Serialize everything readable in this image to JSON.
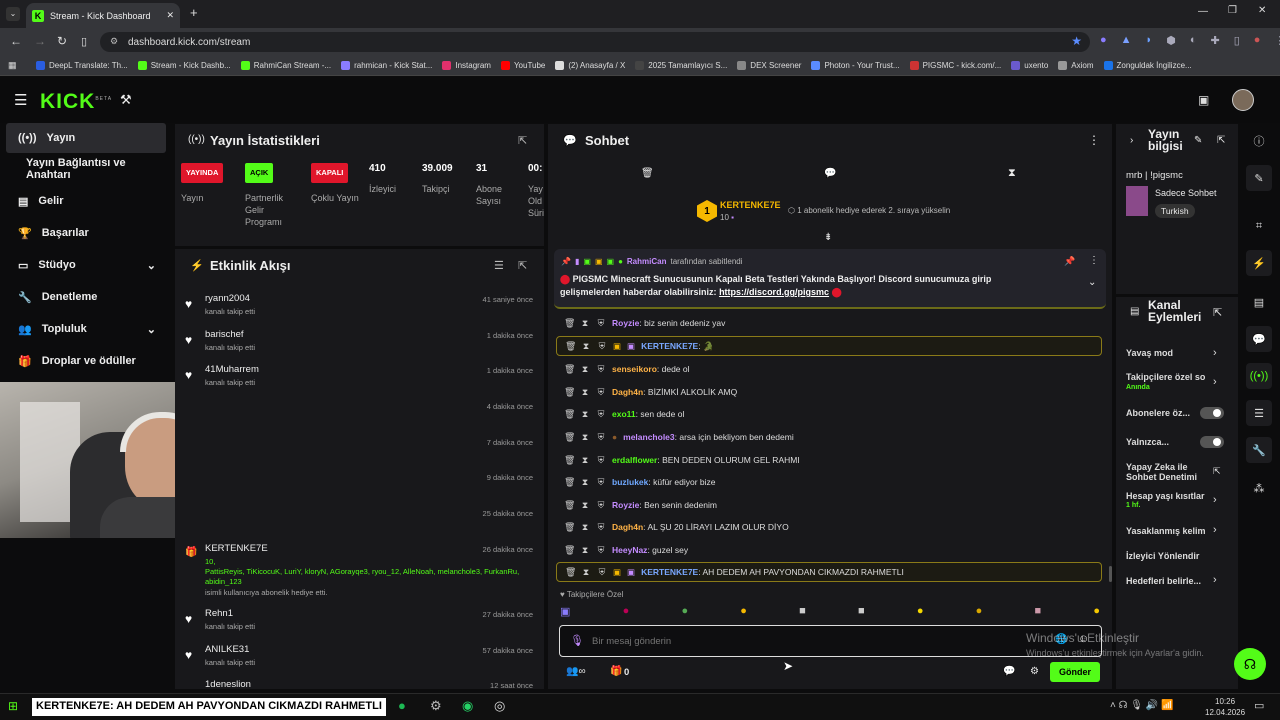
{
  "browser": {
    "tab_title": "Stream - Kick Dashboard",
    "url": "dashboard.kick.com/stream",
    "bookmarks": [
      "DeepL Translate: Th...",
      "Stream - Kick Dashb...",
      "RahmiCan Stream -...",
      "rahmican - Kick Stat...",
      "Instagram",
      "YouTube",
      "(2) Anasayfa / X",
      "2025 Tamamlayıcı S...",
      "DEX Screener",
      "Photon - Your Trust...",
      "PIGSMC - kick.com/...",
      "uxento",
      "Axiom",
      "Zonguldak İngilizce..."
    ]
  },
  "brand": {
    "logo": "KICK",
    "beta": "BETA",
    "accent": "#53fc18"
  },
  "sidebar": {
    "items": [
      {
        "label": "Yayın"
      },
      {
        "label": "Yayın Bağlantısı ve Anahtarı"
      },
      {
        "label": "Gelir"
      },
      {
        "label": "Başarılar"
      },
      {
        "label": "Stüdyo"
      },
      {
        "label": "Denetleme"
      },
      {
        "label": "Topluluk"
      },
      {
        "label": "Droplar ve ödüller"
      }
    ]
  },
  "stats": {
    "title": "Yayın İstatistikleri",
    "live_badge": "YAYINDA",
    "live_label": "Yayın",
    "partner_badge": "AÇIK",
    "partner_label": "Partnerlik Gelir Programı",
    "multi_badge": "KAPALI",
    "multi_label": "Çoklu Yayın",
    "viewers_value": "410",
    "viewers_label": "İzleyici",
    "followers_value": "39.009",
    "followers_label": "Takipçi",
    "subs_value": "31",
    "subs_label": "Abone Sayısı",
    "extra_value": "00:",
    "extra_label": "Yay Old Süri"
  },
  "activity": {
    "title": "Etkinlik Akışı",
    "events": [
      {
        "name": "ryann2004",
        "sub": "kanalı takip etti",
        "time": "41 saniye önce"
      },
      {
        "name": "barischef",
        "sub": "kanalı takip etti",
        "time": "1 dakika önce"
      },
      {
        "name": "41Muharrem",
        "sub": "kanalı takip etti",
        "time": "1 dakika önce"
      },
      {
        "name": "",
        "sub": "",
        "time": "4 dakika önce"
      },
      {
        "name": "",
        "sub": "",
        "time": "7 dakika önce"
      },
      {
        "name": "",
        "sub": "",
        "time": "9 dakika önce"
      },
      {
        "name": "",
        "sub": "",
        "time": "25 dakika önce"
      }
    ],
    "gift_event": {
      "name": "KERTENKE7E",
      "count": "10,",
      "recipients": "PattisReyis, TiKicocuK, LuriY, kloryN, AGorayqe3, ryou_12, AlleNoah, melanchole3, FurkanRu, abidin_123",
      "sub": "isimli kullanıcıya abonelik hediye etti.",
      "time": "26 dakika önce"
    },
    "events_after": [
      {
        "name": "Rehn1",
        "sub": "kanalı takip etti",
        "time": "27 dakika önce"
      },
      {
        "name": "ANILKE31",
        "sub": "kanalı takip etti",
        "time": "57 dakika önce"
      },
      {
        "name": "1deneslion",
        "sub": "",
        "time": "12 saat önce"
      }
    ]
  },
  "chat": {
    "title": "Sohbet",
    "leader": {
      "rank": "1",
      "name": "KERTENKE7E",
      "count": "10",
      "note": "1 abonelik hediye ederek 2. sıraya yükselin"
    },
    "pinned": {
      "by": "RahmiCan",
      "by_suffix": "tarafından sabitlendi",
      "text": "PIGSMC Minecraft Sunucusunun Kapalı Beta Testleri Yakında Başlıyor! Discord sunucumuza girip gelişmelerden haberdar olabilirsiniz:",
      "link": "https://discord.gg/pigsmc"
    },
    "messages": [
      {
        "user": "Royzie",
        "color": "#c48cff",
        "text": "biz senin dedeniz yav"
      },
      {
        "user": "KERTENKE7E",
        "color": "#7aa8ff",
        "text": "🐊"
      },
      {
        "user": "senseikoro",
        "color": "#ffb347",
        "text": "dede ol"
      },
      {
        "user": "Dagh4n",
        "color": "#ffb347",
        "text": "BİZİMKİ ALKOLİK AMQ"
      },
      {
        "user": "exo11",
        "color": "#53fc18",
        "text": "sen dede ol"
      },
      {
        "user": "melanchole3",
        "color": "#c48cff",
        "text": "arsa için bekliyom ben dedemi"
      },
      {
        "user": "erdalflower",
        "color": "#53fc18",
        "text": "BEN DEDEN OLURUM GEL RAHMI"
      },
      {
        "user": "buzlukek",
        "color": "#6fa8ff",
        "text": "küfür ediyor bize"
      },
      {
        "user": "Royzie",
        "color": "#c48cff",
        "text": "Ben senin dedenim"
      },
      {
        "user": "Dagh4n",
        "color": "#ffb347",
        "text": "AL ŞU 20 LİRAYI LAZIM OLUR DİYO"
      },
      {
        "user": "HeeyNaz",
        "color": "#c48cff",
        "text": "guzel sey"
      },
      {
        "user": "KERTENKE7E",
        "color": "#7aa8ff",
        "text": "AH DEDEM AH PAVYONDAN CIKMAZDI RAHMETLI"
      }
    ],
    "emote_label": "Takipçilere Özel",
    "input_placeholder": "Bir mesaj gönderin",
    "count": "0",
    "send_label": "Gönder"
  },
  "stream_info": {
    "title": "Yayın bilgisi",
    "stream_title": "mrb | !pigsmc",
    "category": "Sadece Sohbet",
    "tag": "Turkish"
  },
  "channel_actions": {
    "title": "Kanal Eylemleri",
    "items": [
      {
        "label": "Yavaş mod",
        "sub": ""
      },
      {
        "label": "Takipçilere özel so",
        "sub": "Anında"
      },
      {
        "label": "Abonelere öz...",
        "sub": ""
      },
      {
        "label": "Yalnızca...",
        "sub": ""
      },
      {
        "label": "Yapay Zeka ile Sohbet Denetimi",
        "sub": ""
      },
      {
        "label": "Hesap yaşı kısıtlar",
        "sub": "1 hf."
      },
      {
        "label": "Yasaklanmış kelim",
        "sub": ""
      },
      {
        "label": "İzleyici Yönlendir",
        "sub": ""
      },
      {
        "label": "Hedefleri belirle...",
        "sub": ""
      }
    ]
  },
  "overlay": {
    "activation_title": "Windows'u Etkinleştir",
    "activation_sub": "Windows'u etkinleştirmek için Ayarlar'a gidin.",
    "ticker": "KERTENKE7E: AH DEDEM AH PAVYONDAN CIKMAZDI RAHMETLI"
  },
  "taskbar": {
    "time": "10:26",
    "date": "12.04.2026"
  }
}
